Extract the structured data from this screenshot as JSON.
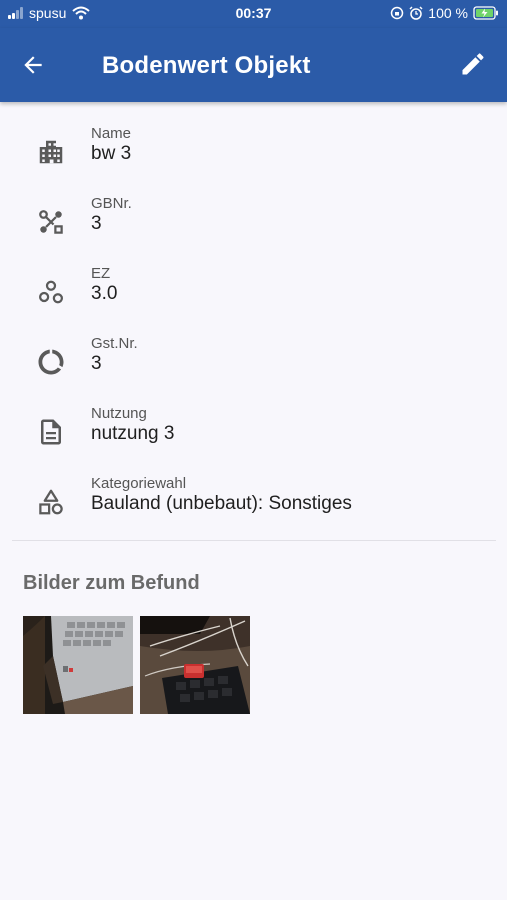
{
  "status_bar": {
    "carrier": "spusu",
    "time": "00:37",
    "battery": "100 %"
  },
  "app_bar": {
    "title": "Bodenwert Objekt",
    "back_icon": "arrow-back-icon",
    "edit_icon": "pencil-icon"
  },
  "fields": [
    {
      "label": "Name",
      "value": "bw 3",
      "icon": "building-icon"
    },
    {
      "label": "GBNr.",
      "value": "3",
      "icon": "connection-icon"
    },
    {
      "label": "EZ",
      "value": "3.0",
      "icon": "bubbles-icon"
    },
    {
      "label": "Gst.Nr.",
      "value": "3",
      "icon": "donut-icon"
    },
    {
      "label": "Nutzung",
      "value": "nutzung 3",
      "icon": "document-icon"
    },
    {
      "label": "Kategoriewahl",
      "value": "Bauland (unbebaut): Sonstiges",
      "icon": "category-icon"
    }
  ],
  "images_section": {
    "title": "Bilder zum Befund",
    "images": [
      "photo-laptop",
      "photo-keyboard"
    ]
  }
}
